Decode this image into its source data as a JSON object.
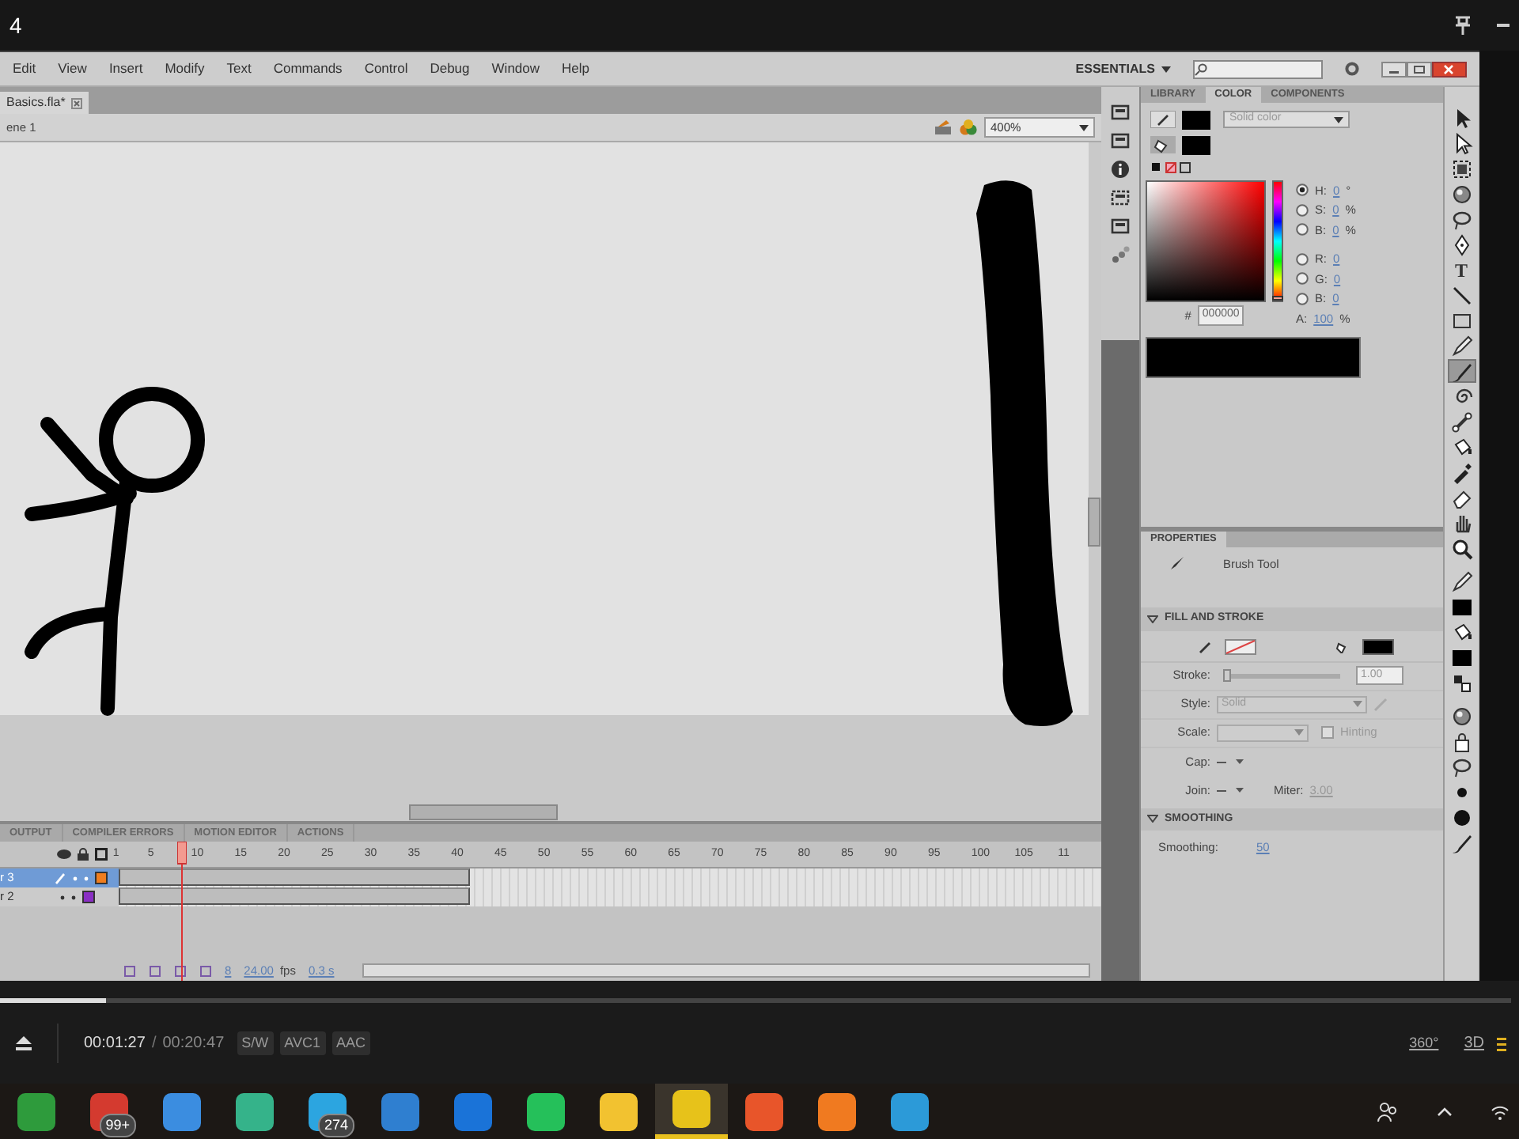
{
  "window": {
    "title": "4"
  },
  "menu": [
    "Edit",
    "View",
    "Insert",
    "Modify",
    "Text",
    "Commands",
    "Control",
    "Debug",
    "Window",
    "Help"
  ],
  "workspace": {
    "label": "ESSENTIALS"
  },
  "document_tab": {
    "title": "Basics.fla*"
  },
  "edit_bar": {
    "scene": "ene 1",
    "zoom": "400%"
  },
  "color_panel": {
    "tabs": [
      {
        "label": "LIBRARY",
        "selected": false
      },
      {
        "label": "COLOR",
        "selected": true
      },
      {
        "label": "COMPONENTS",
        "selected": false
      }
    ],
    "fill_type": "Solid color",
    "hue_slider": {
      "level": 0
    },
    "channels": [
      {
        "label": "H:",
        "value": "0",
        "unit": "°",
        "selected": true
      },
      {
        "label": "S:",
        "value": "0",
        "unit": "%",
        "selected": false
      },
      {
        "label": "B:",
        "value": "0",
        "unit": "%",
        "selected": false
      },
      {
        "label": "R:",
        "value": "0",
        "selected": false
      },
      {
        "label": "G:",
        "value": "0",
        "selected": false
      },
      {
        "label": "B:",
        "value": "0",
        "selected": false
      }
    ],
    "hex_label": "#",
    "hex": "000000",
    "alpha_label": "A:",
    "alpha": "100",
    "alpha_unit": "%"
  },
  "properties": {
    "title": "PROPERTIES",
    "tool": "Brush Tool",
    "fill_stroke": "FILL AND STROKE",
    "stroke_label": "Stroke:",
    "stroke_value": "1.00",
    "stroke_slider": {
      "level": 0
    },
    "style_label": "Style:",
    "style_value": "Solid",
    "scale_label": "Scale:",
    "hinting": {
      "label": "Hinting",
      "checked": false
    },
    "cap_label": "Cap:",
    "join_label": "Join:",
    "miter_label": "Miter:",
    "miter_value": "3.00",
    "smoothing_title": "SMOOTHING",
    "smoothing_label": "Smoothing:",
    "smoothing_value": "50"
  },
  "tools": [
    {
      "kind": "arrow",
      "selected": false
    },
    {
      "kind": "subarrow",
      "selected": false
    },
    {
      "kind": "transform",
      "selected": false
    },
    {
      "kind": "sphere",
      "selected": false
    },
    {
      "kind": "lasso",
      "selected": false
    },
    {
      "kind": "pen",
      "selected": false
    },
    {
      "kind": "text",
      "glyph": "T",
      "selected": false
    },
    {
      "kind": "line",
      "selected": false
    },
    {
      "kind": "rect",
      "selected": false
    },
    {
      "kind": "pencil",
      "selected": false
    },
    {
      "kind": "brush",
      "selected": true
    },
    {
      "kind": "spiral",
      "selected": false
    },
    {
      "kind": "bone",
      "selected": false
    },
    {
      "kind": "bucket",
      "selected": false
    },
    {
      "kind": "dropper",
      "selected": false
    },
    {
      "kind": "eraser",
      "selected": false
    },
    {
      "kind": "hand",
      "selected": false
    },
    {
      "kind": "zoom",
      "selected": false
    },
    {
      "kind": "pencil",
      "selected": false
    },
    {
      "kind": "swatch",
      "selected": false
    },
    {
      "kind": "bucket",
      "selected": false
    },
    {
      "kind": "swatch",
      "selected": false
    },
    {
      "kind": "swap",
      "selected": false
    },
    {
      "kind": "sphere",
      "selected": false
    },
    {
      "kind": "lock",
      "selected": false
    },
    {
      "kind": "lasso",
      "selected": false
    },
    {
      "kind": "dot",
      "selected": false
    },
    {
      "kind": "bigdot",
      "selected": false
    },
    {
      "kind": "brush",
      "selected": false
    }
  ],
  "timeline": {
    "tabs": [
      "OUTPUT",
      "COMPILER ERRORS",
      "MOTION EDITOR",
      "ACTIONS"
    ],
    "frame_numbers": [
      "1",
      "5",
      "10",
      "15",
      "20",
      "25",
      "30",
      "35",
      "40",
      "45",
      "50",
      "55",
      "60",
      "65",
      "70",
      "75",
      "80",
      "85",
      "90",
      "95",
      "100",
      "105",
      "11"
    ],
    "layers": [
      {
        "name": "r 3",
        "selected": true,
        "color": "#f07d1e"
      },
      {
        "name": "r 2",
        "selected": false,
        "color": "#8a2fc4"
      }
    ],
    "current_frame": "8",
    "fps": "24.00",
    "fps_unit": "fps",
    "elapsed": "0.3 s"
  },
  "player": {
    "current": "00:01:27",
    "separator": "/",
    "total": "00:20:47",
    "tags": [
      "S/W",
      "AVC1",
      "AAC"
    ],
    "badge_360": "360°",
    "badge_3d": "3D",
    "level": 0.07
  },
  "taskbar": {
    "apps": [
      {
        "color": "#2e9b3c",
        "selected": false
      },
      {
        "color": "#d43a2f",
        "badge": "99+",
        "selected": false
      },
      {
        "color": "#3b8de0",
        "selected": false
      },
      {
        "color": "#35b38a",
        "selected": false
      },
      {
        "color": "#2ca5e0",
        "badge": "274",
        "selected": false
      },
      {
        "color": "#2f7fd0",
        "selected": false
      },
      {
        "color": "#1a73d8",
        "selected": false
      },
      {
        "color": "#25c05a",
        "selected": false
      },
      {
        "color": "#f2c230",
        "selected": false
      },
      {
        "color": "#e7c21a",
        "selected": true
      },
      {
        "color": "#e8552a",
        "selected": false
      },
      {
        "color": "#f07a20",
        "selected": false
      },
      {
        "color": "#2c9ad8",
        "selected": false
      }
    ]
  }
}
